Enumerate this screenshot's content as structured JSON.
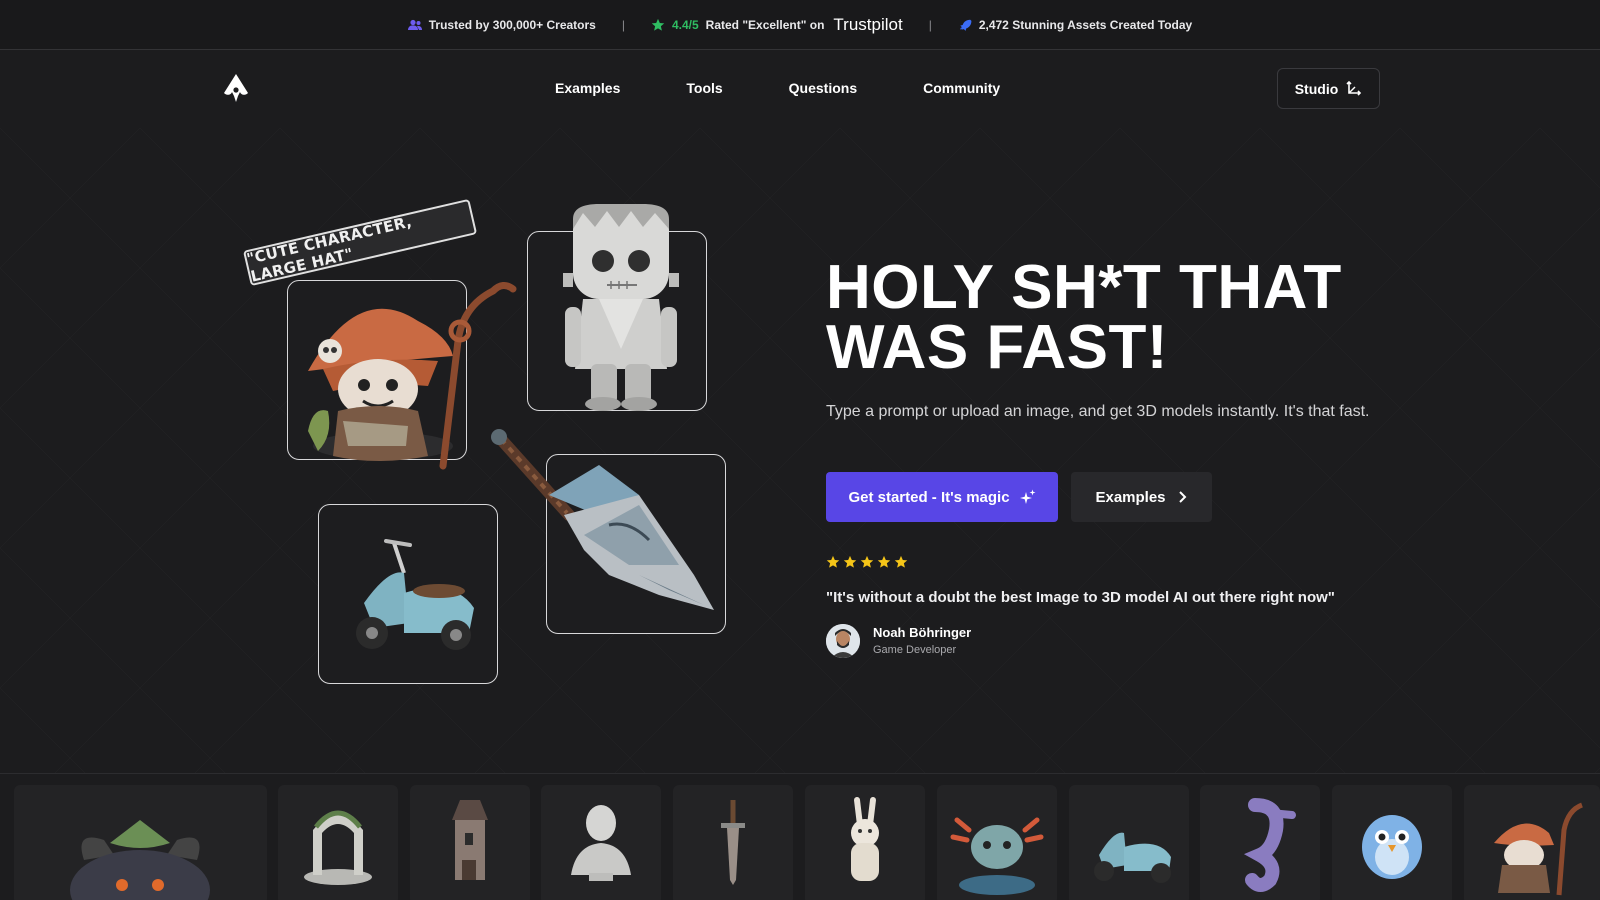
{
  "topbar": {
    "trusted": "Trusted by 300,000+ Creators",
    "rating_score": "4.4/5",
    "rating_text": "Rated \"Excellent\" on",
    "trustpilot": "Trustpilot",
    "assets": "2,472 Stunning Assets Created Today",
    "separator": "|"
  },
  "nav": {
    "links": [
      "Examples",
      "Tools",
      "Questions",
      "Community"
    ],
    "studio": "Studio"
  },
  "hero": {
    "tag": "\"CUTE CHARACTER, LARGE HAT\"",
    "headline_line1": "HOLY SH*T THAT",
    "headline_line2": "WAS FAST!",
    "subtext": "Type a prompt or upload an image, and get 3D models instantly. It's that fast.",
    "primary_button": "Get started - It's magic",
    "secondary_button": "Examples",
    "rating_stars": 5,
    "quote": "\"It's without a doubt the best Image to 3D model AI out there right now\"",
    "author_name": "Noah Böhringer",
    "author_role": "Game Developer"
  },
  "colors": {
    "background": "#1c1c1e",
    "primary": "#5846e6",
    "star": "#f5c518",
    "trustpilot_green": "#2fbd62"
  },
  "gallery": {
    "items": [
      "creature",
      "arch",
      "tower",
      "bust",
      "sword",
      "llama",
      "axolotl",
      "scooter",
      "seahorse",
      "bird",
      "wizard"
    ]
  }
}
